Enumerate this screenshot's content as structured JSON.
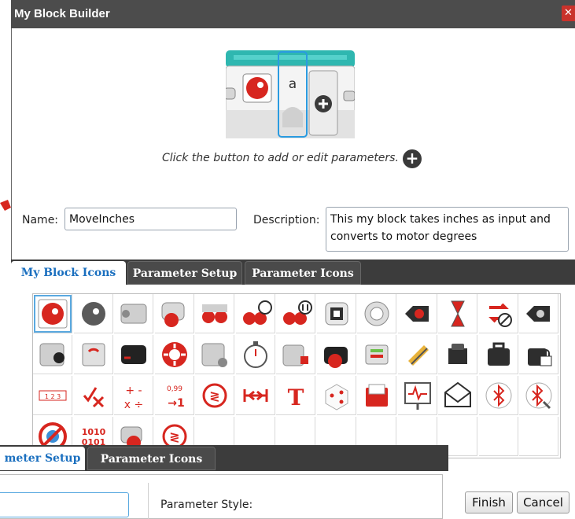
{
  "window": {
    "title": "My Block Builder",
    "close_glyph": "✕"
  },
  "preview": {
    "param_letter": "a",
    "hint": "Click the button to add or edit parameters."
  },
  "form": {
    "name_label": "Name:",
    "name_value": "MoveInches",
    "description_label": "Description:",
    "description_value": "This my block takes inches as input and converts to motor degrees"
  },
  "tabs": [
    {
      "label": "My Block Icons",
      "active": true
    },
    {
      "label": "Parameter Setup",
      "active": false
    },
    {
      "label": "Parameter Icons",
      "active": false
    }
  ],
  "icons": [
    "head-gears-red-icon",
    "head-gears-gray-icon",
    "medium-motor-icon",
    "large-motor-icon",
    "two-motors-icon",
    "move-steering-icon",
    "move-tank-icon",
    "display-icon",
    "sound-icon",
    "brick-buttons-icon",
    "timer-icon",
    "loop-interrupt-icon",
    "brick-status-light-icon",
    "color-sensor-icon",
    "gyro-sensor-icon",
    "infrared-sensor-icon",
    "brick-button-sensor-icon",
    "ultrasonic-sensor-icon",
    "stopwatch-icon",
    "touch-sensor-icon",
    "motor-rotation-icon",
    "temperature-sensor-icon",
    "energy-meter-icon",
    "sound-sensor-icon",
    "toolbox-icon",
    "lock-icon",
    "array-123-icon",
    "logic-icon",
    "math-icon",
    "round-icon",
    "compare-icon",
    "range-icon",
    "text-icon",
    "random-icon",
    "file-access-icon",
    "data-logging-icon",
    "messaging-icon",
    "bluetooth-icon",
    "bluetooth-wrench-icon",
    "unregulated-motor-icon",
    "binary-icon",
    "invert-motor-icon",
    "compare-red-icon"
  ],
  "overlay": {
    "tabs": [
      "meter Setup",
      "Parameter Icons"
    ],
    "param_style_label": "Parameter Style:"
  },
  "buttons": {
    "finish": "Finish",
    "cancel": "Cancel"
  },
  "colors": {
    "accent_blue": "#1a6fbf",
    "lego_red": "#d7261f",
    "teal": "#2fb7b0",
    "dark_bar": "#3c3c3c"
  }
}
